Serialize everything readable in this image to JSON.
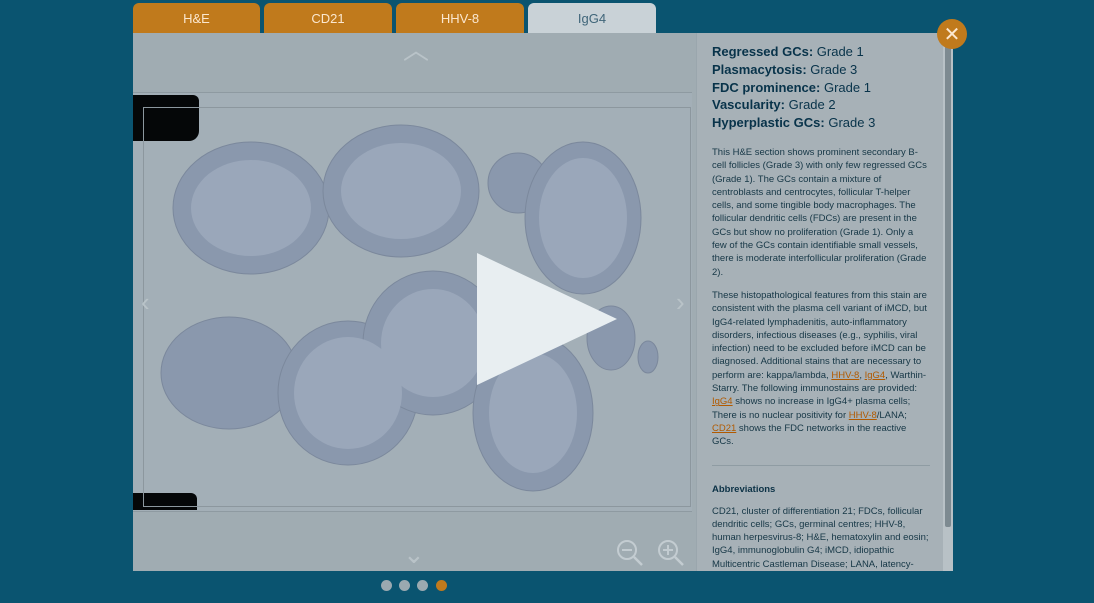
{
  "tabs": [
    {
      "label": "H&E",
      "active": false
    },
    {
      "label": "CD21",
      "active": false
    },
    {
      "label": "HHV-8",
      "active": false
    },
    {
      "label": "IgG4",
      "active": true
    }
  ],
  "grades": [
    {
      "label": "Regressed GCs:",
      "value": "Grade 1"
    },
    {
      "label": "Plasmacytosis:",
      "value": "Grade 3"
    },
    {
      "label": "FDC prominence:",
      "value": "Grade 1"
    },
    {
      "label": "Vascularity:",
      "value": "Grade 2"
    },
    {
      "label": "Hyperplastic GCs:",
      "value": "Grade 3"
    }
  ],
  "description": {
    "para1": "This H&E section shows prominent secondary B-cell follicles (Grade 3) with only few regressed GCs (Grade 1). The GCs contain a mixture of centroblasts and centrocytes, follicular T-helper cells, and some tingible body macrophages. The follicular dendritic cells (FDCs) are present in the GCs but show no proliferation (Grade 1). Only a few of the GCs contain identifiable small vessels, there is moderate interfollicular proliferation (Grade 2).",
    "para2_a": "These histopathological features from this stain are consistent with the plasma cell variant of iMCD, but IgG4-related lymphadenitis, auto-inflammatory disorders, infectious diseases (e.g., syphilis, viral infection) need to be excluded before iMCD can be diagnosed. Additional stains that are necessary to perform are: kappa/lambda, ",
    "link_hhv8_1": "HHV-8",
    "sep1": ", ",
    "link_igg4_1": "IgG4",
    "para2_b": ", Warthin-Starry. The following immunostains are provided: ",
    "link_igg4_2": "IgG4",
    "para2_c": " shows no increase in IgG4+ plasma cells; There is no nuclear positivity for ",
    "link_hhv8_2": "HHV-8",
    "para2_d": "/LANA; ",
    "link_cd21": "CD21",
    "para2_e": " shows the FDC networks in the reactive GCs."
  },
  "abbreviations": {
    "title": "Abbreviations",
    "text": "CD21, cluster of differentiation 21; FDCs, follicular dendritic cells; GCs, germinal centres; HHV-8, human herpesvirus-8; H&E, hematoxylin and eosin; IgG4, immunoglobulin G4; iMCD, idiopathic Multicentric Castleman Disease; LANA, latency-associated nuclear antigen."
  },
  "icons": {
    "close": "✕",
    "up": "︿",
    "down": "⌄",
    "prev": "‹",
    "next": "›"
  },
  "pager": {
    "count": 4,
    "active_index": 3
  },
  "colors": {
    "accent": "#c07a1c",
    "background": "#0a5470"
  }
}
